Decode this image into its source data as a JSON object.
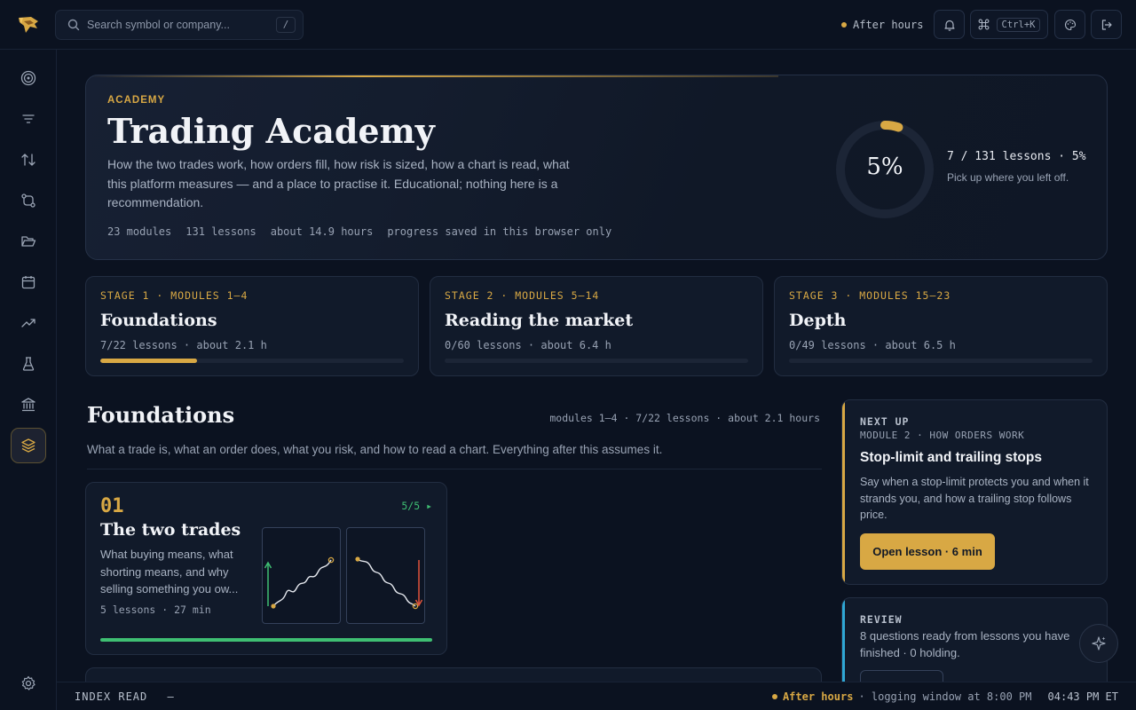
{
  "topbar": {
    "search_placeholder": "Search symbol or company...",
    "search_shortcut": "/",
    "market_status": "After hours",
    "command_shortcut": "Ctrl+K"
  },
  "sidebar": {
    "items": [
      {
        "icon": "target-icon",
        "label": ""
      },
      {
        "icon": "filter-icon",
        "label": ""
      },
      {
        "icon": "sort-arrows-icon",
        "label": ""
      },
      {
        "icon": "route-icon",
        "label": ""
      },
      {
        "icon": "folder-open-icon",
        "label": ""
      },
      {
        "icon": "calendar-icon",
        "label": ""
      },
      {
        "icon": "trend-up-icon",
        "label": ""
      },
      {
        "icon": "flask-icon",
        "label": ""
      },
      {
        "icon": "bank-icon",
        "label": ""
      },
      {
        "icon": "layers-icon",
        "label": "",
        "active": true
      }
    ],
    "footer_icon": "settings-icon"
  },
  "hero": {
    "eyebrow": "ACADEMY",
    "title": "Trading Academy",
    "description": "How the two trades work, how orders fill, how risk is sized, how a chart is read, what this platform measures — and a place to practise it. Educational; nothing here is a recommendation.",
    "meta": [
      "23 modules",
      "131 lessons",
      "about 14.9 hours",
      "progress saved in this browser only"
    ],
    "progress_pct_label": "5%",
    "progress_fraction": 0.05,
    "lessons_count": "7 / 131 lessons · 5%",
    "resume_text": "Pick up where you left off."
  },
  "stages": [
    {
      "eyebrow": "STAGE 1 · MODULES 1–4",
      "title": "Foundations",
      "meta": "7/22 lessons · about 2.1 h",
      "progress": 0.318
    },
    {
      "eyebrow": "STAGE 2 · MODULES 5–14",
      "title": "Reading the market",
      "meta": "0/60 lessons · about 6.4 h",
      "progress": 0
    },
    {
      "eyebrow": "STAGE 3 · MODULES 15–23",
      "title": "Depth",
      "meta": "0/49 lessons · about 6.5 h",
      "progress": 0
    }
  ],
  "section": {
    "title": "Foundations",
    "meta": "modules 1–4 · 7/22 lessons · about 2.1 hours",
    "description": "What a trade is, what an order does, what you risk, and how to read a chart. Everything after this assumes it."
  },
  "module": {
    "number": "01",
    "progress_label": "5/5 ▸",
    "title": "The two trades",
    "description": "What buying means, what shorting means, and why selling something you ow...",
    "meta": "5 lessons · 27 min",
    "progress": 1
  },
  "next_up": {
    "eyebrow": "NEXT UP",
    "sub": "MODULE 2 · HOW ORDERS WORK",
    "title": "Stop-limit and trailing stops",
    "description": "Say when a stop-limit protects you and when it strands you, and how a trailing stop follows price.",
    "button": "Open lesson · 6 min"
  },
  "review": {
    "eyebrow": "REVIEW",
    "description": "8 questions ready from lessons you have finished · 0 holding."
  },
  "statusbar": {
    "left_label": "INDEX READ",
    "left_value": "–",
    "market_status": "After hours",
    "window_note": "· logging window at 8:00 PM",
    "time": "04:43 PM ET"
  },
  "colors": {
    "accent": "#d8a844",
    "success": "#3fbf73",
    "info": "#2fa7d4",
    "background": "#0b1220"
  }
}
